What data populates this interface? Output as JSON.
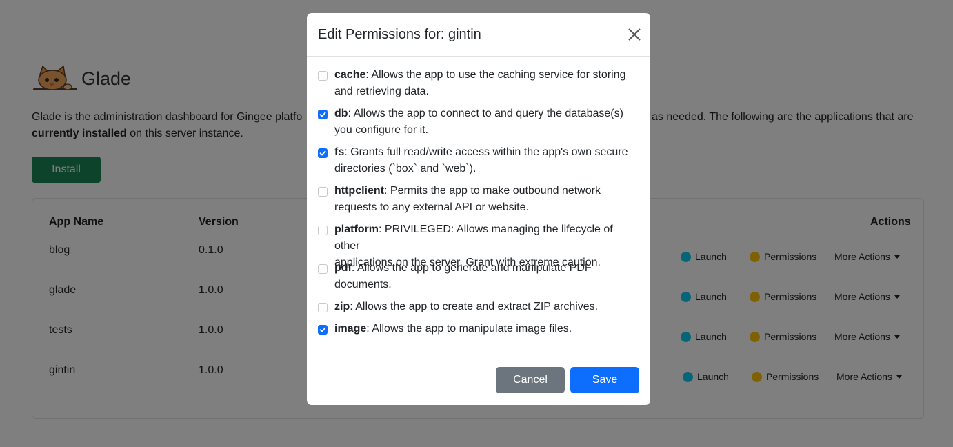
{
  "app": {
    "brand": "Glade",
    "intro_left": "Glade is the administration dashboard for Gingee platfo",
    "intro_right": "as needed. The following are the applications that are",
    "intro_bold": "currently installed",
    "intro_tail": " on this server instance.",
    "install_label": "Install"
  },
  "table": {
    "headers": [
      "App Name",
      "Version",
      "Actions"
    ],
    "rows": [
      {
        "name": "blog",
        "version": "0.1.0"
      },
      {
        "name": "glade",
        "version": "1.0.0"
      },
      {
        "name": "tests",
        "version": "1.0.0"
      },
      {
        "name": "gintin",
        "version": "1.0.0"
      }
    ],
    "actions": {
      "launch": "Launch",
      "permissions": "Permissions",
      "more": "More Actions"
    }
  },
  "modal": {
    "title": "Edit Permissions for: gintin",
    "permissions": [
      {
        "name": "cache",
        "checked": false,
        "line1": "Allows the app to use the caching service for storing",
        "line2": "and retrieving data."
      },
      {
        "name": "db",
        "checked": true,
        "line1": "Allows the app to connect to and query the database(s)",
        "line2": "you configure for it."
      },
      {
        "name": "fs",
        "checked": true,
        "line1": "Grants full read/write access within the app's own secure",
        "line2": "directories (`box` and `web`)."
      },
      {
        "name": "httpclient",
        "checked": false,
        "line1": "Permits the app to make outbound network",
        "line2": "requests to any external API or website."
      },
      {
        "name": "platform",
        "checked": false,
        "line1": "PRIVILEGED: Allows managing the lifecycle of other",
        "line2": "applications on the server. Grant with extreme caution."
      },
      {
        "name": "pdf",
        "checked": false,
        "line1": "Allows the app to generate and manipulate PDF",
        "line2": "documents."
      },
      {
        "name": "zip",
        "checked": false,
        "line1": "Allows the app to create and extract ZIP archives.",
        "line2": ""
      },
      {
        "name": "image",
        "checked": true,
        "line1": "Allows the app to manipulate image files.",
        "line2": ""
      }
    ],
    "cancel_label": "Cancel",
    "save_label": "Save"
  },
  "colors": {
    "primary": "#0d6efd",
    "secondary": "#6c757d",
    "success": "#198754",
    "info": "#0dcaf0",
    "warning": "#ffc107"
  }
}
